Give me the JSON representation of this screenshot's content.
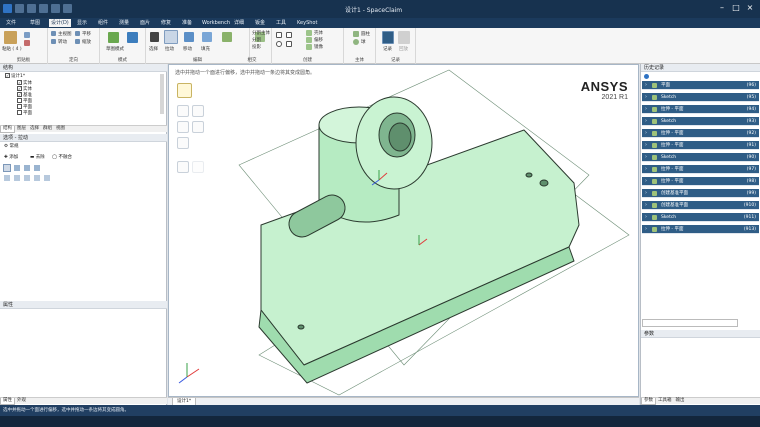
{
  "title": "设计1 - SpaceClaim",
  "menus": [
    "文件",
    "草图",
    "设计(D)",
    "显示",
    "组件",
    "测量",
    "面片",
    "修复",
    "准备",
    "Workbench",
    "详细",
    "钣金",
    "工具",
    "KeyShot"
  ],
  "ribbon": {
    "groups": [
      {
        "label": "剪贴板",
        "items": [
          "粘贴",
          "粘贴 ( 4 )"
        ]
      },
      {
        "label": "定向",
        "items": [
          "主视图",
          "平移",
          "缩放",
          "转动",
          "旋转"
        ]
      },
      {
        "label": "模式",
        "items": [
          "草图模式"
        ]
      },
      {
        "label": "编辑",
        "items": [
          "选择",
          "拉动",
          "移动",
          "填充"
        ]
      },
      {
        "label": "相交",
        "items": [
          "组合",
          "分割主体",
          "分割",
          "投影"
        ]
      },
      {
        "label": "创建",
        "items": [
          "壳体",
          "偏移",
          "镜像"
        ]
      },
      {
        "label": "主体",
        "items": [
          "圆柱",
          "球"
        ]
      },
      {
        "label": "记录",
        "items": [
          "记录",
          "回放"
        ]
      }
    ]
  },
  "left": {
    "structure_title": "结构",
    "tree": [
      "设计1*",
      "实体",
      "实体",
      "基准",
      "平面",
      "平面",
      "平面"
    ],
    "tabs": [
      "结构",
      "图层",
      "选择",
      "群组",
      "视图"
    ],
    "options_title": "选项 - 拉动",
    "options_sub": "常规",
    "options_tools": [
      "添加",
      "去除",
      "不融合"
    ],
    "props_title": "属性",
    "bottom_tabs": [
      "属性",
      "外观"
    ]
  },
  "viewport": {
    "hint": "选中并拖动一个面进行偏移，选中并拖动一条边将其变成圆角。",
    "brand": "ANSYS",
    "version": "2021 R1",
    "tab_label": "设计1*"
  },
  "right": {
    "history_title": "历史记录",
    "history": [
      {
        "label": "平面",
        "num": "(96)"
      },
      {
        "label": "Sketch",
        "num": "(95)"
      },
      {
        "label": "拉伸 - 平面",
        "num": "(94)"
      },
      {
        "label": "Sketch",
        "num": "(93)"
      },
      {
        "label": "拉伸 - 平面",
        "num": "(92)"
      },
      {
        "label": "拉伸 - 平面",
        "num": "(91)"
      },
      {
        "label": "Sketch",
        "num": "(90)"
      },
      {
        "label": "拉伸 - 平面",
        "num": "(97)"
      },
      {
        "label": "拉伸 - 平面",
        "num": "(98)"
      },
      {
        "label": "创建基准平面",
        "num": "(99)"
      },
      {
        "label": "创建基准平面",
        "num": "(910)"
      },
      {
        "label": "Sketch",
        "num": "(911)"
      },
      {
        "label": "拉伸 - 平面",
        "num": "(913)"
      }
    ],
    "params_title": "参数",
    "bottom_tabs": [
      "参数",
      "工具箱",
      "输出"
    ]
  },
  "status": {
    "text": "选中并拖动一个面进行偏移，选中并拖动一条边将其变成圆角。"
  },
  "colors": {
    "accent": "#2f5d86",
    "model": "#b8ecc4",
    "model_edge": "#2b3a2f"
  }
}
